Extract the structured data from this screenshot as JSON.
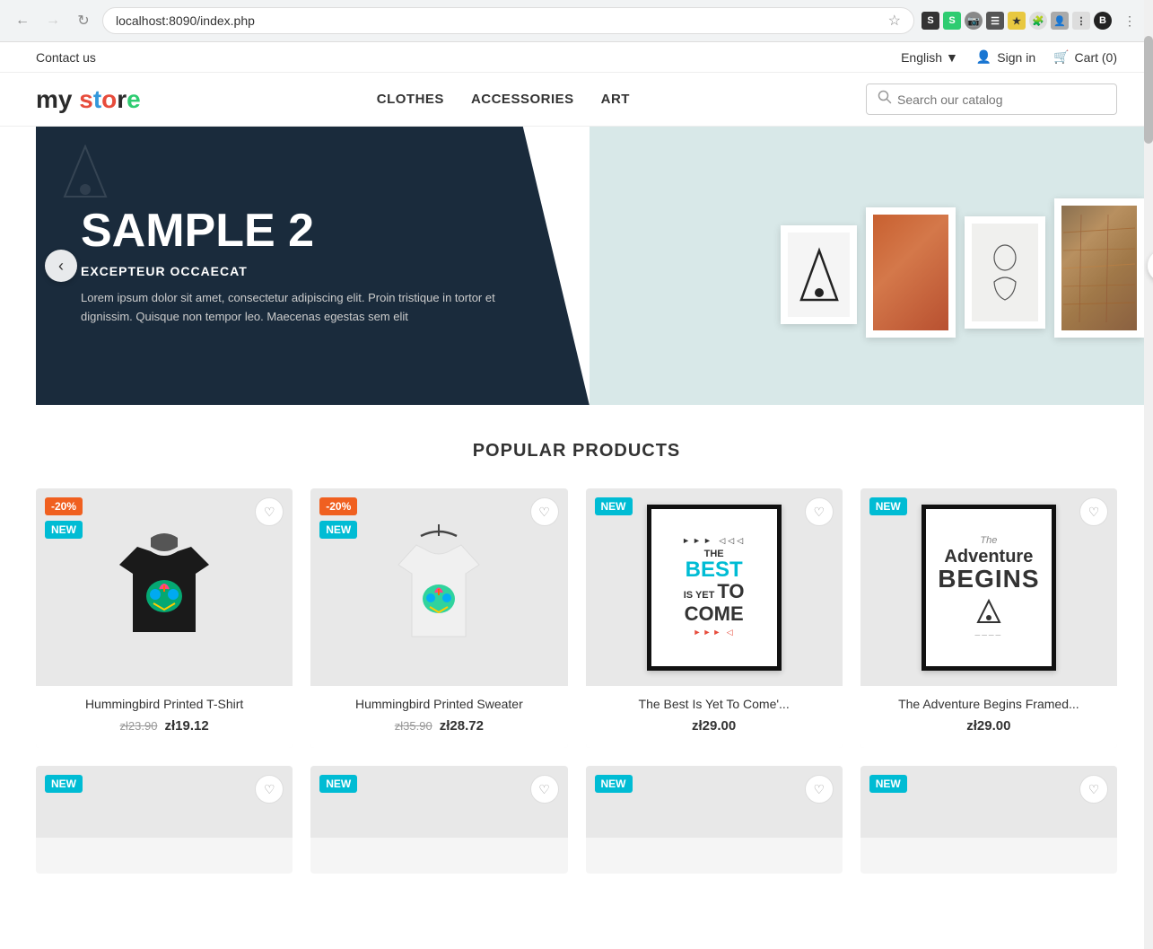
{
  "browser": {
    "url": "localhost:8090/index.php",
    "back_disabled": false,
    "forward_disabled": true
  },
  "topbar": {
    "contact": "Contact us",
    "language": "English",
    "sign_in": "Sign in",
    "cart": "Cart (0)"
  },
  "logo": {
    "text": "my store"
  },
  "nav": {
    "items": [
      {
        "label": "CLOTHES",
        "href": "#"
      },
      {
        "label": "ACCESSORIES",
        "href": "#"
      },
      {
        "label": "ART",
        "href": "#"
      }
    ]
  },
  "search": {
    "placeholder": "Search our catalog"
  },
  "carousel": {
    "slide_label": "SAMPLE 2",
    "subtitle": "EXCEPTEUR OCCAECAT",
    "body": "Lorem ipsum dolor sit amet, consectetur adipiscing elit. Proin tristique in tortor et dignissim. Quisque non tempor leo. Maecenas egestas sem elit"
  },
  "popular_products": {
    "title": "POPULAR PRODUCTS",
    "products": [
      {
        "name": "Hummingbird Printed T-Shirt",
        "price_old": "zł23.90",
        "price_new": "zł19.12",
        "badge_discount": "-20%",
        "badge_new": "NEW",
        "type": "tshirt-black"
      },
      {
        "name": "Hummingbird Printed Sweater",
        "price_old": "zł35.90",
        "price_new": "zł28.72",
        "badge_discount": "-20%",
        "badge_new": "NEW",
        "type": "tshirt-white"
      },
      {
        "name": "The Best Is Yet To Come'...",
        "price_only": "zł29.00",
        "badge_new": "NEW",
        "type": "best-poster"
      },
      {
        "name": "The Adventure Begins Framed...",
        "price_only": "zł29.00",
        "badge_new": "NEW",
        "type": "adventure-poster"
      }
    ],
    "bottom_row": [
      {
        "badge_new": "NEW",
        "type": "bottom"
      },
      {
        "badge_new": "NEW",
        "type": "bottom"
      },
      {
        "badge_new": "NEW",
        "type": "bottom"
      },
      {
        "badge_new": "NEW",
        "type": "bottom"
      }
    ]
  },
  "colors": {
    "accent_red": "#e74c3c",
    "accent_blue": "#3498db",
    "accent_green": "#2ecc71",
    "badge_orange": "#f06020",
    "badge_cyan": "#00bcd4",
    "dark_navy": "#1a2b3c"
  }
}
